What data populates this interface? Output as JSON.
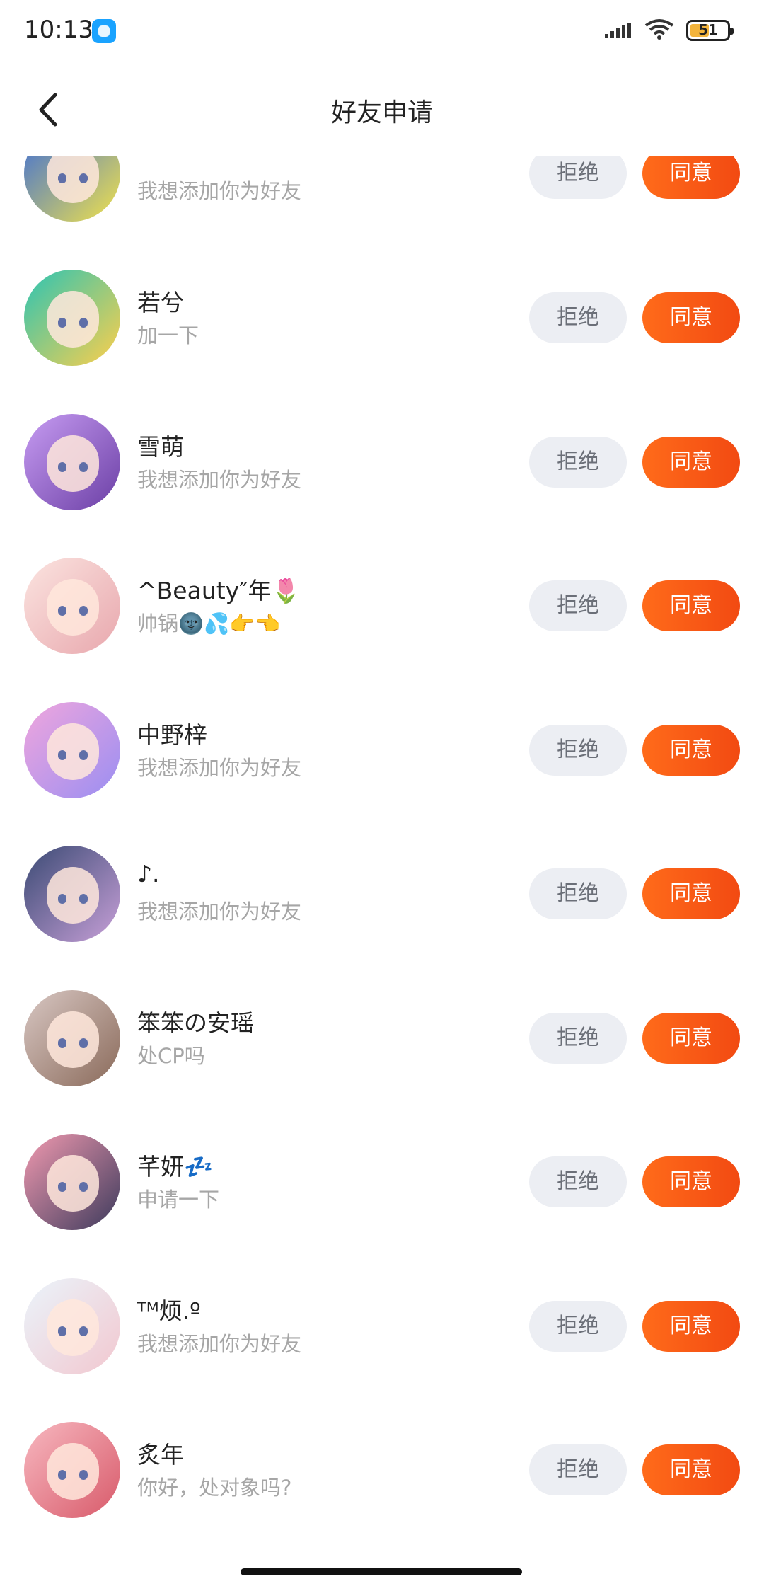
{
  "status_bar": {
    "time": "10:13",
    "battery": "51",
    "battery_level": 0.51,
    "icons": [
      "app-notification-icon",
      "signal-icon",
      "wifi-icon",
      "battery-icon"
    ]
  },
  "header": {
    "title": "好友申请",
    "back_icon": "chevron-left-icon"
  },
  "buttons": {
    "reject": "拒绝",
    "accept": "同意"
  },
  "requests": [
    {
      "name": "",
      "message": "我想添加你为好友"
    },
    {
      "name": "若兮",
      "message": "加一下"
    },
    {
      "name": "雪萌",
      "message": "我想添加你为好友"
    },
    {
      "name": "^Beauty″年🌷",
      "message": "帅锅🌚💦👉👈"
    },
    {
      "name": "中野梓",
      "message": "我想添加你为好友"
    },
    {
      "name": "♪.",
      "message": "我想添加你为好友"
    },
    {
      "name": "笨笨の安瑶",
      "message": "处CP吗"
    },
    {
      "name": "芊妍💤",
      "message": "申请一下"
    },
    {
      "name": "ᵀᴹ烦.º",
      "message": "我想添加你为好友"
    },
    {
      "name": "炙年",
      "message": "你好，处对象吗?"
    }
  ],
  "colors": {
    "accept": "#F65616",
    "reject_bg": "#ECEEF3",
    "secondary_text": "#A6A6A6"
  }
}
